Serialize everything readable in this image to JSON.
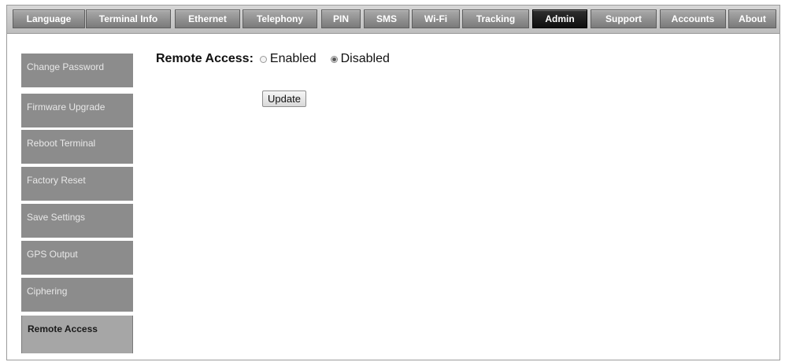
{
  "tabs": [
    {
      "label": "Language"
    },
    {
      "label": "Terminal Info"
    },
    {
      "label": "Ethernet"
    },
    {
      "label": "Telephony"
    },
    {
      "label": "PIN"
    },
    {
      "label": "SMS"
    },
    {
      "label": "Wi-Fi"
    },
    {
      "label": "Tracking"
    },
    {
      "label": "Admin"
    },
    {
      "label": "Support"
    },
    {
      "label": "Accounts"
    },
    {
      "label": "About"
    }
  ],
  "active_tab": "Admin",
  "sidebar": {
    "items": [
      {
        "label": "Change Password"
      },
      {
        "label": "Firmware Upgrade"
      },
      {
        "label": "Reboot Terminal"
      },
      {
        "label": "Factory Reset"
      },
      {
        "label": "Save Settings"
      },
      {
        "label": "GPS Output"
      },
      {
        "label": "Ciphering"
      },
      {
        "label": "Remote Access"
      }
    ],
    "active": "Remote Access"
  },
  "remote_access": {
    "title": "Remote Access:",
    "options": [
      {
        "label": "Enabled",
        "checked": false
      },
      {
        "label": "Disabled",
        "checked": true
      }
    ],
    "update_label": "Update"
  }
}
